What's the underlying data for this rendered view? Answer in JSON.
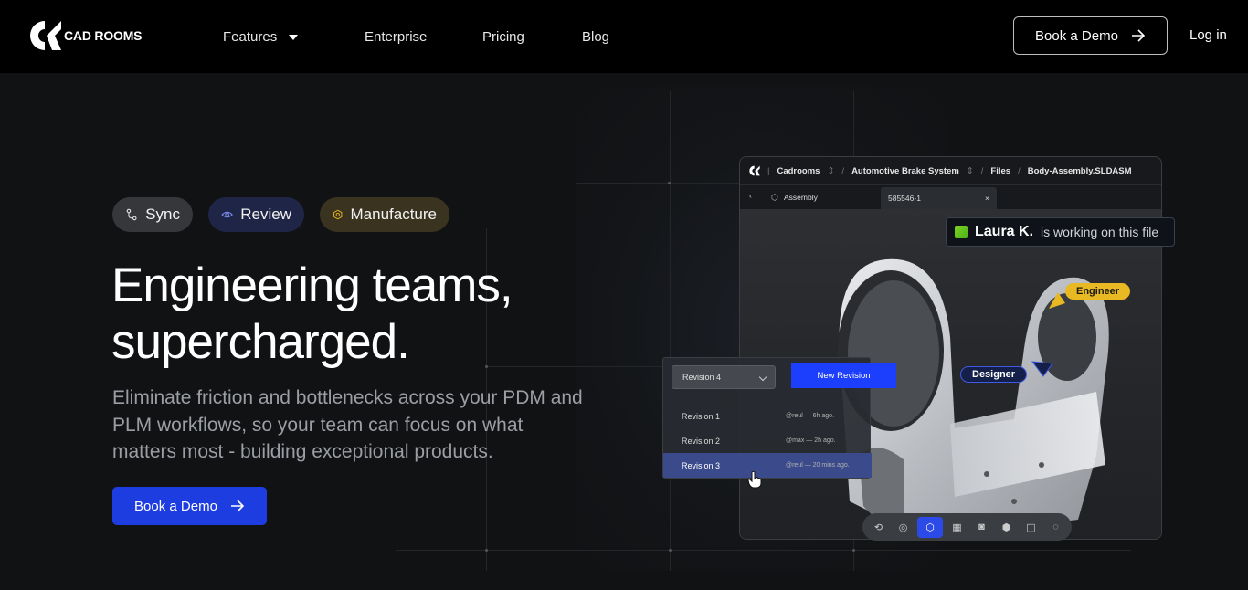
{
  "brand": {
    "name": "CAD ROOMS"
  },
  "nav": {
    "features": "Features",
    "enterprise": "Enterprise",
    "pricing": "Pricing",
    "blog": "Blog",
    "book_demo": "Book a Demo",
    "login": "Log in"
  },
  "tags": {
    "sync": "Sync",
    "review": "Review",
    "manufacture": "Manufacture"
  },
  "hero": {
    "title_line1": "Engineering teams,",
    "title_line2": "supercharged.",
    "subtitle": "Eliminate friction and bottlenecks across your PDM and PLM workflows, so your team can focus on what matters most - building exceptional products.",
    "cta": "Book a Demo"
  },
  "app": {
    "workspace": "Cadrooms",
    "project": "Automotive Brake System",
    "folder": "Files",
    "file": "Body-Assembly.SLDASM",
    "assembly_label": "Assembly",
    "tab_id": "585546-1",
    "presence_name": "Laura K.",
    "presence_text": "is working on this file",
    "engineer_label": "Engineer",
    "designer_label": "Designer",
    "revision_selected": "Revision 4",
    "new_revision": "New Revision",
    "revisions": [
      {
        "name": "Revision 1",
        "meta": "@reul — 6h ago."
      },
      {
        "name": "Revision 2",
        "meta": "@max — 2h ago."
      },
      {
        "name": "Revision 3",
        "meta": "@reul — 20 mins ago."
      }
    ]
  },
  "colors": {
    "accent": "#1e3de0",
    "engineer": "#e8b923",
    "designer": "#14204a",
    "presence": "#7ed321"
  }
}
